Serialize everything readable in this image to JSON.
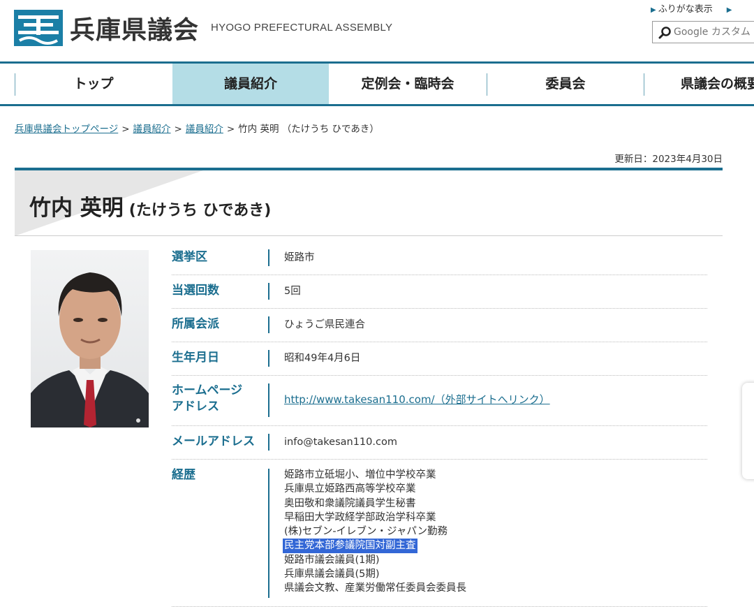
{
  "header": {
    "title": "兵庫県議会",
    "title_en": "HYOGO PREFECTURAL ASSEMBLY",
    "links": [
      "ふりがな表示",
      ""
    ],
    "search_placeholder": "Google カスタム"
  },
  "nav": {
    "items": [
      "トップ",
      "議員紹介",
      "定例会・臨時会",
      "委員会",
      "県議会の概要"
    ],
    "active_index": 1
  },
  "breadcrumb": {
    "items": [
      "兵庫県議会トップページ",
      "議員紹介",
      "議員紹介"
    ],
    "separator": ">",
    "current": "竹内 英明 （たけうち ひであき）"
  },
  "updated": "更新日：2023年4月30日",
  "member": {
    "name": "竹内 英明",
    "kana": "(たけうち ひであき)"
  },
  "profile": {
    "district_label": "選挙区",
    "district_value": "姫路市",
    "elected_label": "当選回数",
    "elected_value": "5回",
    "faction_label": "所属会派",
    "faction_value": "ひょうご県民連合",
    "birthday_label": "生年月日",
    "birthday_value": "昭和49年4月6日",
    "homepage_label_1": "ホームページ",
    "homepage_label_2": "アドレス",
    "homepage_value": "http://www.takesan110.com/（外部サイトへリンク）",
    "email_label": "メールアドレス",
    "email_value": "info@takesan110.com",
    "career_label": "経歴",
    "career": [
      "姫路市立砥堀小、増位中学校卒業",
      "兵庫県立姫路西高等学校卒業",
      "奥田敬和衆議院議員学生秘書",
      "早稲田大学政経学部政治学科卒業",
      "(株)セブン-イレブン・ジャパン勤務",
      "民主党本部参議院国対副主査",
      "姫路市議会議員(1期)",
      "兵庫県議会議員(5期)",
      "県議会文教、産業労働常任委員会委員長"
    ],
    "career_selected_index": 5
  },
  "colors": {
    "accent": "#1b6e8f",
    "nav_active": "#b4dde6",
    "selection": "#3367d6"
  }
}
